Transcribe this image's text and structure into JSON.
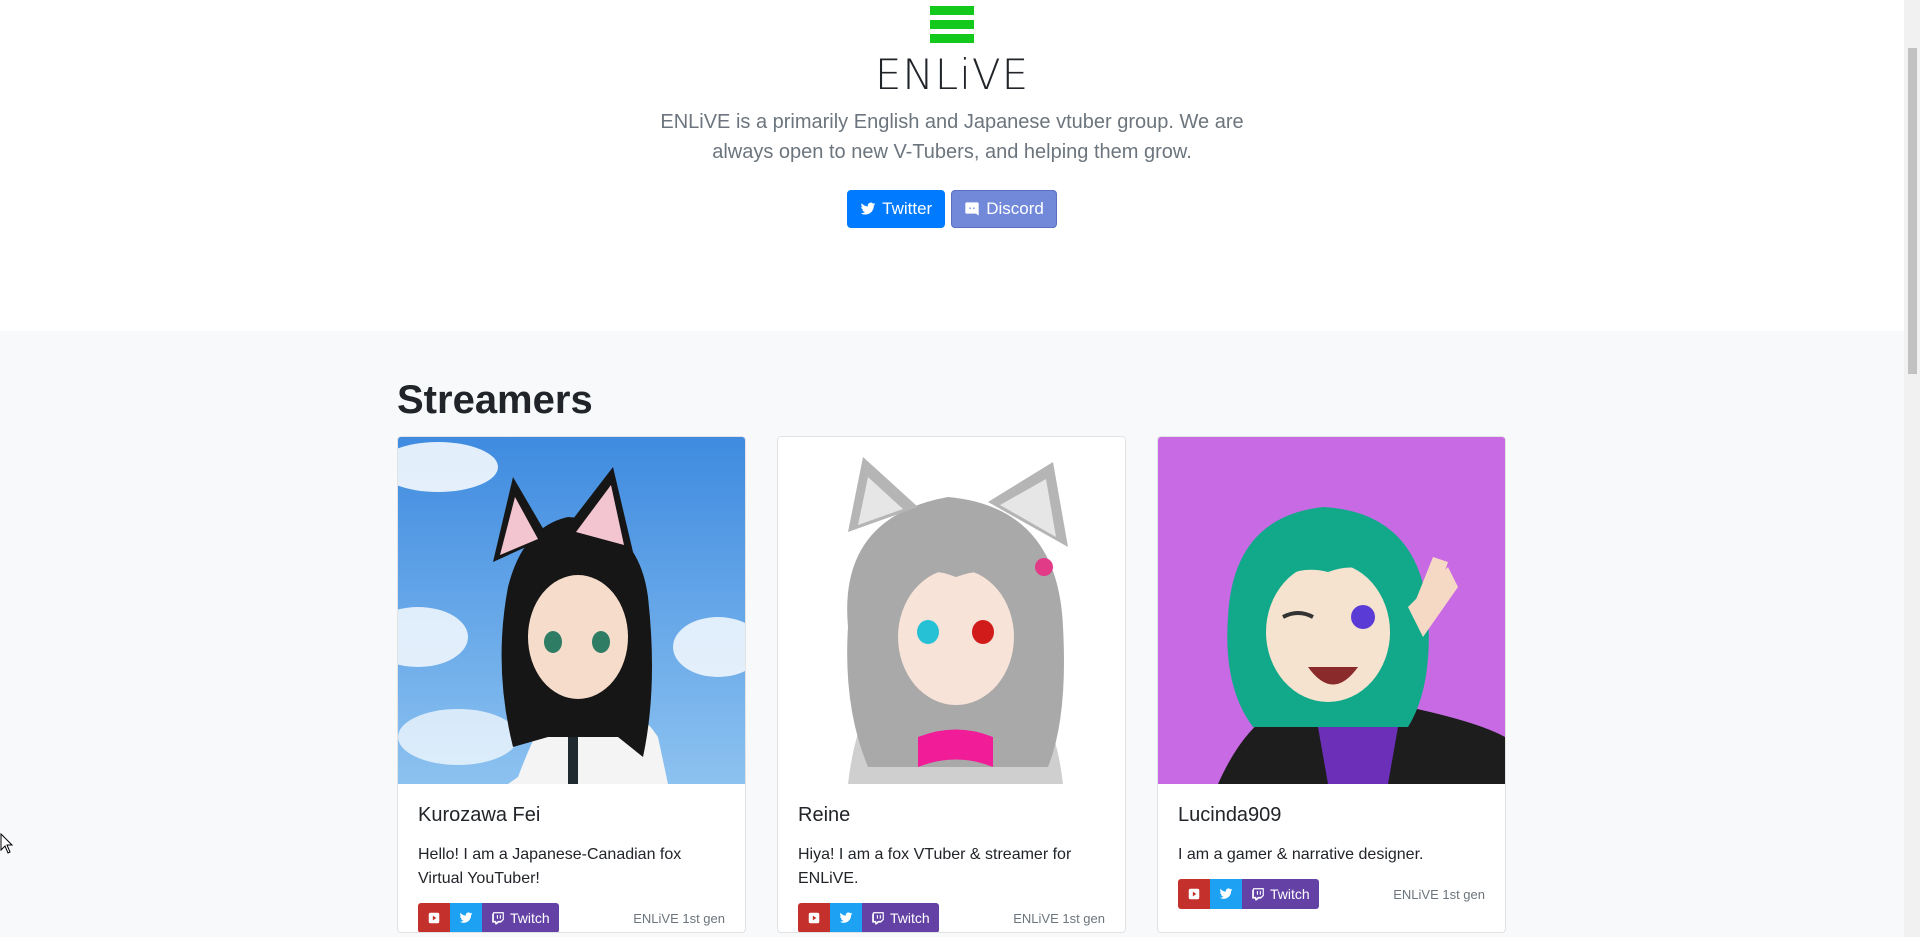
{
  "header": {
    "brand": "ENLiVE",
    "tagline": "ENLiVE is a primarily English and Japanese vtuber group. We are always open to new V-Tubers, and helping them grow.",
    "twitter_label": "Twitter",
    "discord_label": "Discord"
  },
  "colors": {
    "logo_green": "#12c91c",
    "twitter_blue": "#007bff",
    "discord_purple": "#7289da",
    "youtube_red": "#c4302b",
    "twitter_light": "#1da1f2",
    "twitch_purple": "#6441a5"
  },
  "streamers": {
    "title": "Streamers",
    "cards": [
      {
        "name": "Kurozawa Fei",
        "description": "Hello! I am a Japanese-Canadian fox Virtual YouTuber!",
        "twitch_label": "Twitch",
        "generation": "ENLiVE 1st gen"
      },
      {
        "name": "Reine",
        "description": "Hiya! I am a fox VTuber & streamer for ENLiVE.",
        "twitch_label": "Twitch",
        "generation": "ENLiVE 1st gen"
      },
      {
        "name": "Lucinda909",
        "description": "I am a gamer & narrative designer.",
        "twitch_label": "Twitch",
        "generation": "ENLiVE 1st gen"
      }
    ]
  },
  "icons": [
    "hamburger-logo-icon",
    "twitter-icon",
    "discord-icon",
    "youtube-icon",
    "twitch-icon",
    "mouse-cursor-icon"
  ]
}
